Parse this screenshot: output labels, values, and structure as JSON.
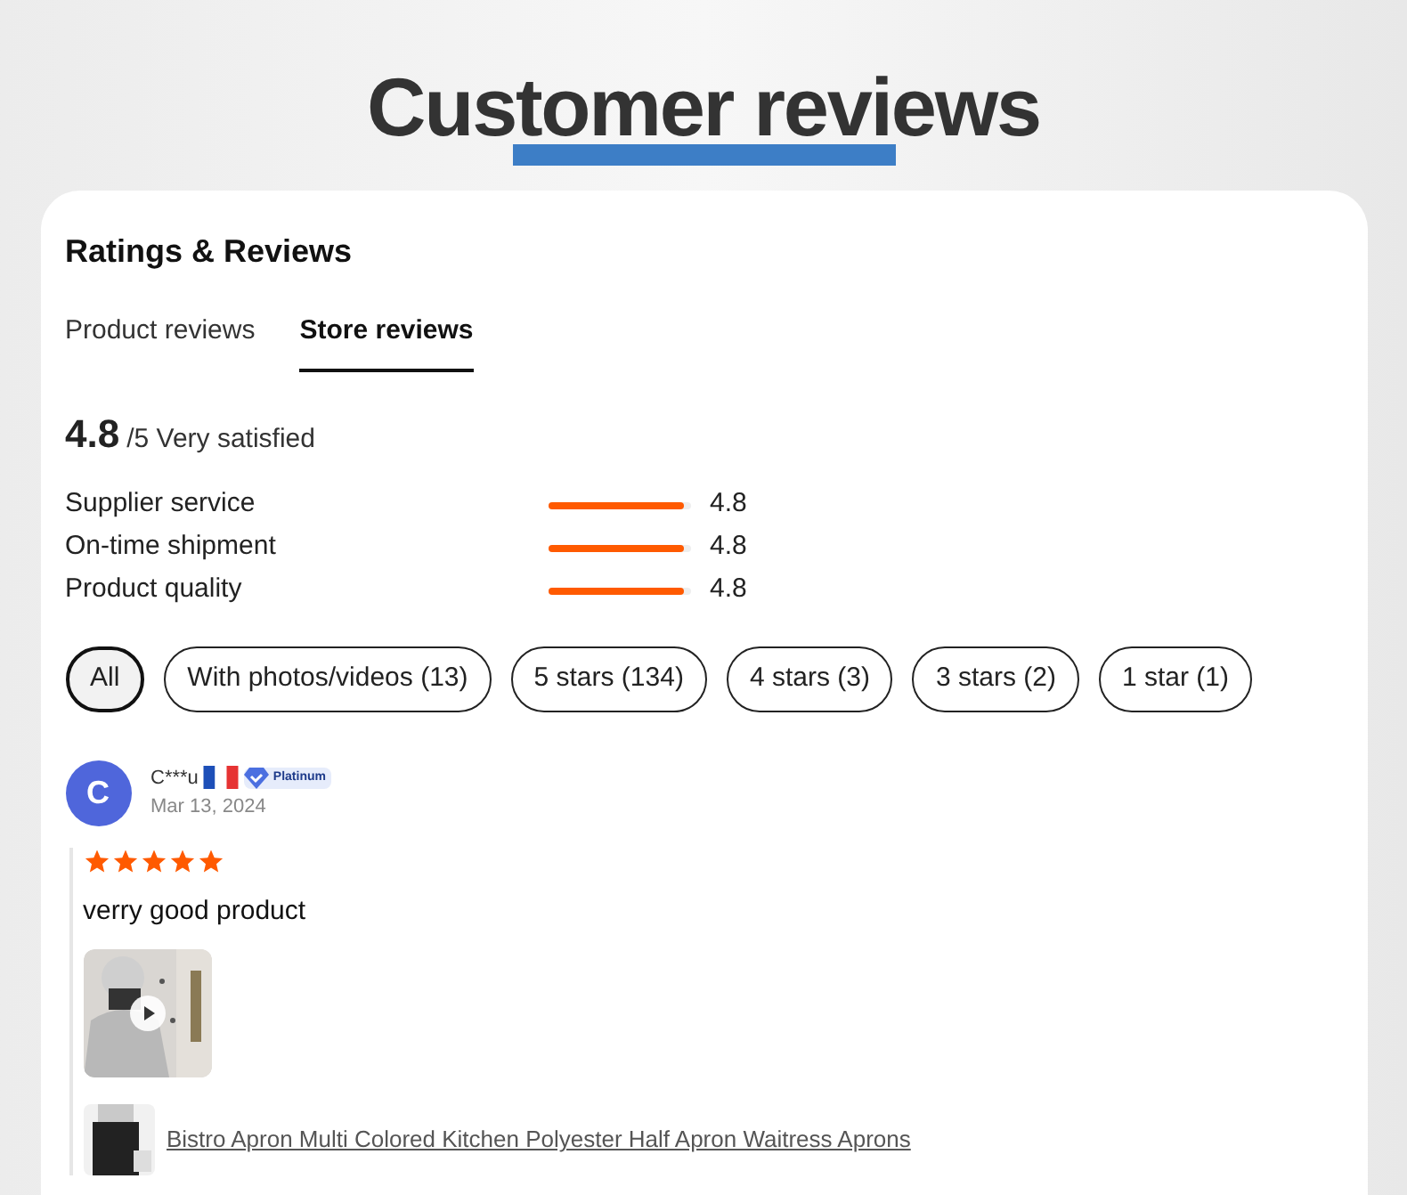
{
  "page_title": "Customer reviews",
  "card": {
    "title": "Ratings & Reviews",
    "tabs": [
      {
        "label": "Product reviews",
        "selected": false
      },
      {
        "label": "Store reviews",
        "selected": true
      }
    ],
    "score": {
      "value": "4.8",
      "suffix": "/5 Very satisfied"
    },
    "metrics": [
      {
        "name": "Supplier service",
        "level": 0.96,
        "reading": "4.8"
      },
      {
        "name": "On-time shipment",
        "level": 0.96,
        "reading": "4.8"
      },
      {
        "name": "Product quality",
        "level": 0.96,
        "reading": "4.8"
      }
    ],
    "filters": [
      {
        "label": "All",
        "selected": true
      },
      {
        "label": "With photos/videos (13)",
        "selected": false
      },
      {
        "label": "5 stars (134)",
        "selected": false
      },
      {
        "label": "4 stars (3)",
        "selected": false
      },
      {
        "label": "3 stars (2)",
        "selected": false
      },
      {
        "label": "1 star (1)",
        "selected": false
      }
    ],
    "reviews": [
      {
        "avatar_letter": "C",
        "user": "C***u",
        "badge": "Platinum",
        "date": "Mar 13, 2024",
        "stars": 5,
        "text": "verry good product",
        "media": [
          {
            "kind": "video"
          }
        ],
        "product": "Bistro Apron Multi Colored Kitchen Polyester Half Apron Waitress Aprons"
      }
    ]
  }
}
